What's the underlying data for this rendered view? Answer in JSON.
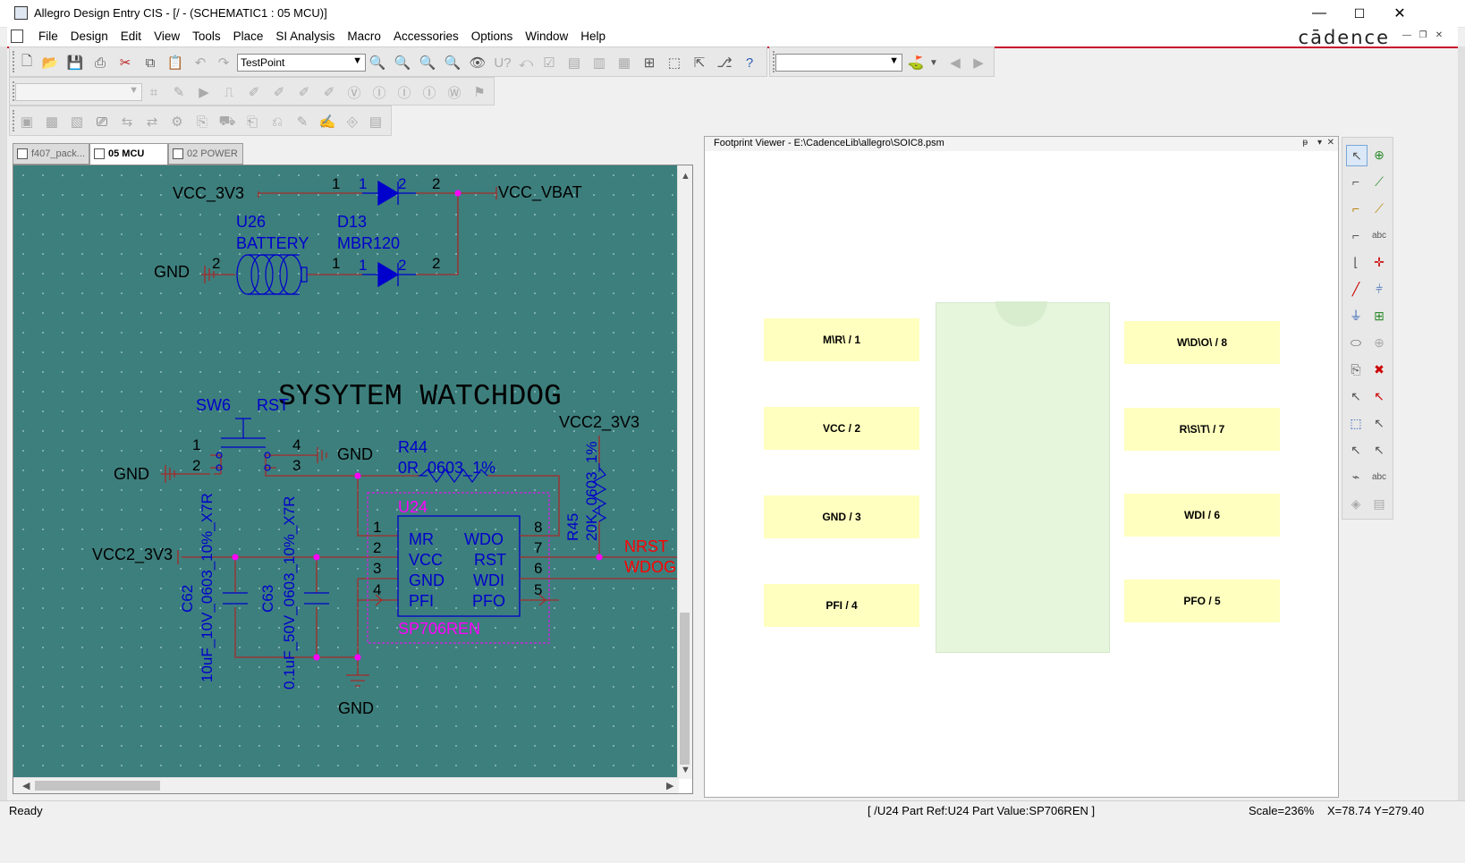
{
  "window": {
    "title": "Allegro Design Entry CIS - [/ - (SCHEMATIC1 : 05 MCU)]",
    "minimize_glyph": "—",
    "maximize_glyph": "☐",
    "close_glyph": "✕"
  },
  "menu": {
    "items": [
      "File",
      "Design",
      "Edit",
      "View",
      "Tools",
      "Place",
      "SI Analysis",
      "Macro",
      "Accessories",
      "Options",
      "Window",
      "Help"
    ],
    "brand": "cādence"
  },
  "toolbar": {
    "part_combo": "TestPoint",
    "search_combo": "",
    "prop_combo": ""
  },
  "tabs": [
    {
      "label": "f407_pack..."
    },
    {
      "label": "05 MCU"
    },
    {
      "label": "02 POWER"
    }
  ],
  "schematic": {
    "title": "SYSYTEM WATCHDOG",
    "net_labels": {
      "vcc_3v3": "VCC_3V3",
      "vcc_vbat": "VCC_VBAT",
      "gnd": "GND",
      "vcc2_3v3": "VCC2_3V3",
      "nrst": "NRST",
      "wdog": "WDOG"
    },
    "parts": {
      "u26_ref": "U26",
      "u26_val": "BATTERY",
      "d13_ref": "D13",
      "d13_val": "MBR120",
      "sw6_ref": "SW6",
      "sw6_val": "RST",
      "r44_ref": "R44",
      "r44_val": "0R_0603_1%",
      "r45_ref": "R45",
      "r45_val": "20K_0603_1%",
      "u24_ref": "U24",
      "u24_val": "SP706REN",
      "c62_ref": "C62",
      "c62_val": "10uF_10V_0603_10%_X7R",
      "c63_ref": "C63",
      "c63_val": "0.1uF_50V_0603_10%_X7R"
    },
    "u24_pins_left": [
      "MR",
      "VCC",
      "GND",
      "PFI"
    ],
    "u24_pins_right": [
      "WDO",
      "RST",
      "WDI",
      "PFO"
    ],
    "pin_numbers": {
      "one": "1",
      "two": "2",
      "three": "3",
      "four": "4",
      "five": "5",
      "six": "6",
      "seven": "7",
      "eight": "8"
    }
  },
  "footprint_viewer": {
    "title": "Footprint Viewer - E:\\CadenceLib\\allegro\\SOIC8.psm",
    "pads_left": [
      "M\\R\\ / 1",
      "VCC / 2",
      "GND / 3",
      "PFI / 4"
    ],
    "pads_right": [
      "W\\D\\O\\ / 8",
      "R\\S\\T\\ / 7",
      "WDI / 6",
      "PFO / 5"
    ],
    "ctl_pin": "ᵽ",
    "ctl_menu": "▾",
    "ctl_close": "✕"
  },
  "status": {
    "left": "Ready",
    "part_info": "[ /U24 Part Ref:U24 Part Value:SP706REN ]",
    "scale": "Scale=236%",
    "coords": "X=78.74  Y=279.40"
  },
  "colors": {
    "schematic_bg": "#3d7f7d",
    "wire": "#a52a2a",
    "part_blue": "#0000cc",
    "magenta": "#ff00ff",
    "net_red": "#ff0000",
    "pad_yellow": "#ffffbf",
    "body_green": "#e6f6dc",
    "menu_accent": "#c8102e"
  }
}
